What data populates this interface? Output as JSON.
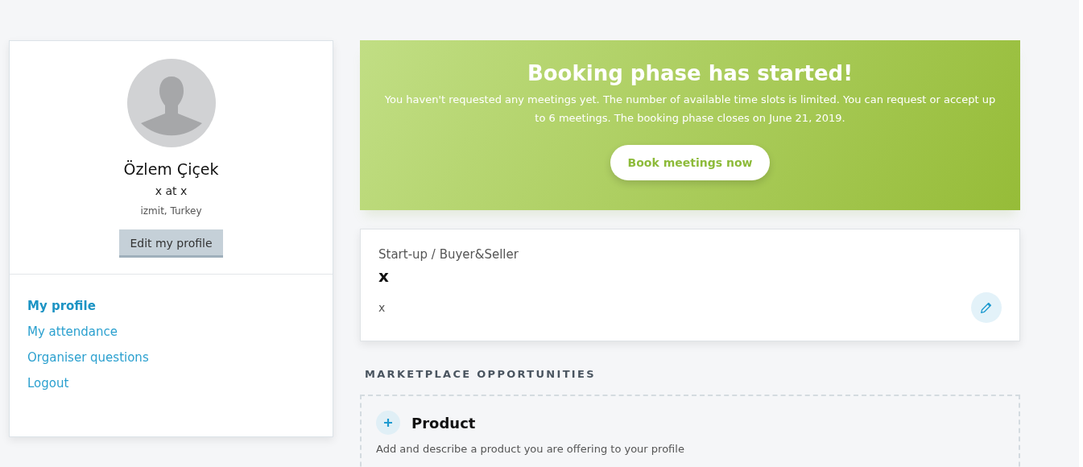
{
  "profile": {
    "name": "Özlem Çiçek",
    "position": "x at x",
    "location": "izmit, Turkey",
    "edit_button": "Edit my profile"
  },
  "menu": [
    {
      "label": "My profile",
      "selected": true
    },
    {
      "label": "My attendance",
      "selected": false
    },
    {
      "label": "Organiser questions",
      "selected": false
    },
    {
      "label": "Logout",
      "selected": false
    }
  ],
  "banner": {
    "title": "Booking phase has started!",
    "text": "You haven't requested any meetings yet. The number of available time slots is limited. You can request or accept up to 6 meetings. The booking phase closes on June 21, 2019.",
    "button": "Book meetings now"
  },
  "company_card": {
    "type": "Start-up / Buyer&Seller",
    "name": "x",
    "description": "x"
  },
  "marketplace": {
    "heading": "MARKETPLACE OPPORTUNITIES",
    "items": [
      {
        "title": "Product",
        "description": "Add and describe a product you are offering to your profile"
      }
    ]
  }
}
